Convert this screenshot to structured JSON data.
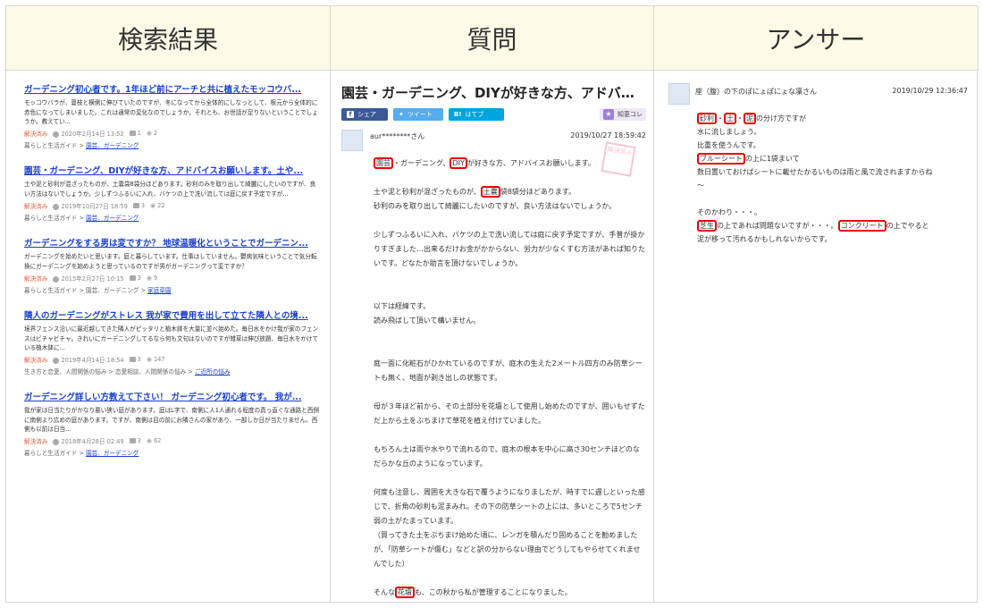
{
  "headers": {
    "results": "検索結果",
    "question": "質問",
    "answer": "アンサー"
  },
  "results": [
    {
      "title": "ガーデニング初心者です。1年ほど前にアーチと共に植えたモッコウバ...",
      "body": "モッコウバラが、蔓枝と横側に伸びていたのですが、冬になってから全体的にしなっとして、根元から全体的に赤色になってしまいました。これは通常の変化なのでしょうか。それとも、お世話が足りないということでしょうか。教えてい...",
      "status": "解決済み",
      "date": "2020年2月14日 13:52",
      "answers": "1",
      "views": "2",
      "cat_prefix": "暮らしと生活ガイド > ",
      "cat_link": "園芸、ガーデニング",
      "cat_link2": ""
    },
    {
      "title": "園芸・ガーデニング、DIYが好きな方、アドバイスお願いします。土や...",
      "body": "土や泥と砂利が混ざったものが、土嚢袋8袋分ほどあります。砂利のみを取り出して綺麗にしたいのですが、良い方法はないでしょうか。少しずつふるいに入れ、バケツの上で洗い流しては庭に戻す予定ですが...",
      "status": "解決済み",
      "date": "2019年10月27日 18:59",
      "answers": "3",
      "views": "22",
      "cat_prefix": "暮らしと生活ガイド > ",
      "cat_link": "園芸、ガーデニング",
      "cat_link2": ""
    },
    {
      "title": "ガーデニングをする男は変ですか？ 地球温暖化ということでガーデニン...",
      "body": "ガーデニングを始めたいと思います。庭と暮らしています。仕事はしていません。鬱病気味ということで気分転換にガーデニングを始めようと思っているのですが男がガーデニングって変ですか？",
      "status": "解決済み",
      "date": "2015年2月27日 10:15",
      "answers": "3",
      "views": "9",
      "cat_prefix": "暮らしと生活ガイド > 園芸、ガーデニング > ",
      "cat_link": "家庭菜園",
      "cat_link2": ""
    },
    {
      "title": "隣人のガーデニングがストレス 我が家で費用を出して立てた隣人との境...",
      "body": "境界フェンス沿いに最近越してきた隣人がピッタリと植木鉢を大量に並べ始めた。毎日水をかけ我が家のフェンスはビチャビチャ。きれいにガーデニングしてるなら何も文句はないのですが雑草は伸び放題、毎日水をかけている植木鉢に...",
      "status": "解決済み",
      "date": "2019年4月14日 18:54",
      "answers": "3",
      "views": "147",
      "cat_prefix": "生き方と恋愛、人間関係の悩み > 恋愛相談、人間関係の悩み > ",
      "cat_link": "ご近所の悩み",
      "cat_link2": ""
    },
    {
      "title": "ガーデニング詳しい方教えて下さい！ ガーデニング初心者です。 我が...",
      "body": "我が家は日当たりがかなり悪い狭い庭があります。庭はL字で、南側に人1人通れる程度の真っ直ぐな通路と西側に南側より広めの庭があります。ですが、南側は目の前にお隣さんの家があり、一部しか日が当たりません。西側も以前は日当...",
      "status": "解決済み",
      "date": "2018年4月28日 02:49",
      "answers": "3",
      "views": "62",
      "cat_prefix": "暮らしと生活ガイド > ",
      "cat_link": "園芸、ガーデニング",
      "cat_link2": ""
    }
  ],
  "question": {
    "title": "園芸・ガーデニング、DIYが好きな方、アドバ…",
    "share_fb": "シェア",
    "share_tw": "ツイート",
    "share_hb": "はてブ",
    "share_chie": "知恵コレ",
    "stamp": "解決済み",
    "user": "aur********さん",
    "date": "2019/10/27  18:59:42",
    "hl_engei": "園芸",
    "line1_mid": "・ガーデニング、",
    "hl_diy": "DIY",
    "line1_end": "が好きな方、アドバイスお願いします。",
    "p2_a": "土や泥と砂利が混ざったものが、",
    "hl_donou": "土嚢",
    "p2_b": "袋8袋分ほどあります。",
    "p2_c": "砂利のみを取り出して綺麗にしたいのですが、良い方法はないでしょうか。",
    "p3": "少しずつふるいに入れ、バケツの上で洗い流しては庭に戻す予定ですが、手普が掛かりすぎました…出来るだけお金がかからない、労力が少なくすむ方法があれば知りたいです。どなたか助言を頂けないでしょうか。",
    "p4": "以下は経緯です。",
    "p4b": "読み飛ばして頂いて構いません。",
    "p5": "庭一面に化粧石がひかれているのですが、庭木の生えた2メートル四方のみ防草シートも無く、地面が剥き出しの状態です。",
    "p6": "母が３年ほど前から、その土部分を花壇として使用し始めたのですが、囲いもせずただ上から土をぶちまけて草花を植え付けていました。",
    "p7": "もちろん土は雨や水やりで流れるので、庭木の根本を中心に高さ30センチほどのなだらかな丘のようになっています。",
    "p8": "何度も注意し、周囲を大きな石で覆うようになりましたが、時すでに遅しといった感じで、折角の砂利も泥まみれ。その下の防草シートの上には、多いところで5センチ弱の土がたまっています。",
    "p8b": "（買ってきた土をぶちまけ始めた頃に、レンガを積んだり固めることを勧めましたが、「防草シートが傷む」などと訳の分からない理由でどうしてもやらせてくれませんでした）",
    "p9_a": "そんな",
    "hl_kadan": "花壇",
    "p9_b": "も、この秋から私が管理することになりました。"
  },
  "answer": {
    "user": "座（腹）の下のぽにょぽにょな凜さん",
    "date": "2019/10/29  12:36:47",
    "hl_jari": "砂利",
    "sep1": "・",
    "hl_tsuchi": "土",
    "sep2": "・",
    "hl_doro": "泥",
    "l1_end": "の分け方ですが",
    "l2": "水に流しましょう。",
    "l3": "比重を使うんです。",
    "hl_blue": "ブルーシート",
    "l4_end": "の上に1袋まいて",
    "l5": "数日置いておけばシートに載せたかるいものは雨と風で流されますからね",
    "l6": "〜",
    "l7": "そのかわり・・・。",
    "hl_shiba": "芝生",
    "l8_mid": "の上であれば問題ないですが・・・。",
    "hl_conc": "コンクリート",
    "l8_end": "の上でやると",
    "l9": "泥が移って汚れるかもしれないからです。"
  }
}
